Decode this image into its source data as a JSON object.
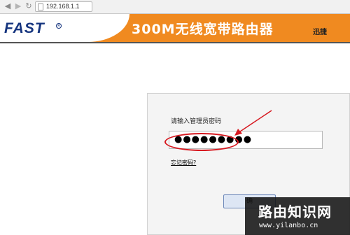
{
  "browser": {
    "url": "192.168.1.1"
  },
  "banner": {
    "logo": "FAST",
    "logo_mark": "R",
    "product_title": "300M无线宽带路由器",
    "brand_sub": "迅捷"
  },
  "login": {
    "password_label": "请输入管理员密码",
    "password_value": "●●●●●●●●●",
    "forgot_link": "忘记密码?",
    "confirm_label": "确"
  },
  "watermark": {
    "title": "路由知识网",
    "url": "www.yilanbo.cn"
  },
  "colors": {
    "banner_orange": "#f08a20",
    "logo_blue": "#16357f",
    "annotation_red": "#d71920"
  }
}
